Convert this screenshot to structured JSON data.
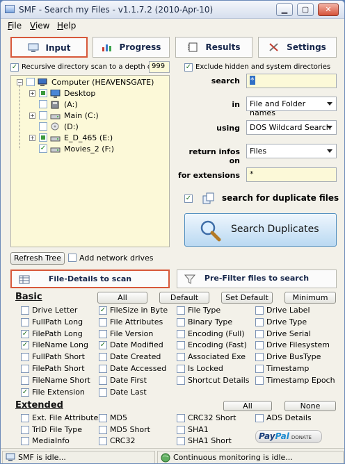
{
  "window": {
    "title": "SMF - Search my Files - v1.1.7.2 (2010-Apr-10)",
    "minimize": "▁",
    "maximize": "▢",
    "close": "✕"
  },
  "menu": [
    {
      "label": "File"
    },
    {
      "label": "View"
    },
    {
      "label": "Help"
    }
  ],
  "tabs": {
    "input": "Input",
    "progress": "Progress",
    "results": "Results",
    "settings": "Settings"
  },
  "scan": {
    "recursive_label": "Recursive directory scan to a depth of",
    "depth": "999",
    "exclude_label": "Exclude hidden and system directories"
  },
  "tree": {
    "root": "Computer (HEAVENSGATE)",
    "nodes": [
      "Desktop",
      "(A:)",
      "Main (C:)",
      "(D:)",
      "E_D_465 (E:)",
      "Movies_2 (F:)"
    ]
  },
  "form": {
    "search_label": "search",
    "search_value": "*",
    "in_label": "in",
    "in_value": "File and Folder names",
    "using_label": "using",
    "using_value": "DOS Wildcard Search",
    "return_label": "return infos on",
    "return_value": "Files",
    "ext_label": "for extensions",
    "ext_value": "*",
    "dup_label": "search for duplicate files",
    "big_button": "Search Duplicates"
  },
  "tree_controls": {
    "refresh": "Refresh Tree",
    "network": "Add network drives"
  },
  "subtabs": {
    "details": "File-Details to scan",
    "prefilter": "Pre-Filter files to search"
  },
  "basic": {
    "heading": "Basic",
    "all": "All",
    "default": "Default",
    "set_default": "Set Default",
    "minimum": "Minimum",
    "col1": [
      {
        "label": "Drive Letter",
        "checked": false
      },
      {
        "label": "FullPath Long",
        "checked": false
      },
      {
        "label": "FilePath Long",
        "checked": true
      },
      {
        "label": "FileName Long",
        "checked": true
      },
      {
        "label": "FullPath Short",
        "checked": false
      },
      {
        "label": "FilePath Short",
        "checked": false
      },
      {
        "label": "FileName Short",
        "checked": false
      },
      {
        "label": "File Extension",
        "checked": true
      }
    ],
    "col2": [
      {
        "label": "FileSize in Byte",
        "checked": true
      },
      {
        "label": "File Attributes",
        "checked": false
      },
      {
        "label": "File Version",
        "checked": false
      },
      {
        "label": "Date Modified",
        "checked": true
      },
      {
        "label": "Date Created",
        "checked": false
      },
      {
        "label": "Date Accessed",
        "checked": false
      },
      {
        "label": "Date First",
        "checked": false
      },
      {
        "label": "Date Last",
        "checked": false
      }
    ],
    "col3": [
      {
        "label": "File Type",
        "checked": false
      },
      {
        "label": "Binary Type",
        "checked": false
      },
      {
        "label": "Encoding (Full)",
        "checked": false
      },
      {
        "label": "Encoding (Fast)",
        "checked": false
      },
      {
        "label": "Associated Exe",
        "checked": false
      },
      {
        "label": "Is Locked",
        "checked": false
      },
      {
        "label": "Shortcut Details",
        "checked": false
      }
    ],
    "col4": [
      {
        "label": "Drive Label",
        "checked": false
      },
      {
        "label": "Drive Type",
        "checked": false
      },
      {
        "label": "Drive Serial",
        "checked": false
      },
      {
        "label": "Drive Filesystem",
        "checked": false
      },
      {
        "label": "Drive BusType",
        "checked": false
      },
      {
        "label": "Timestamp",
        "checked": false
      },
      {
        "label": "Timestamp Epoch",
        "checked": false
      }
    ]
  },
  "extended": {
    "heading": "Extended",
    "all": "All",
    "none": "None",
    "col1": [
      {
        "label": "Ext. File Attributes",
        "checked": false
      },
      {
        "label": "TrID File Type",
        "checked": false
      },
      {
        "label": "MediaInfo",
        "checked": false
      }
    ],
    "col2": [
      {
        "label": "MD5",
        "checked": false
      },
      {
        "label": "MD5 Short",
        "checked": false
      },
      {
        "label": "CRC32",
        "checked": false
      }
    ],
    "col3": [
      {
        "label": "CRC32 Short",
        "checked": false
      },
      {
        "label": "SHA1",
        "checked": false
      },
      {
        "label": "SHA1 Short",
        "checked": false
      }
    ],
    "col4": [
      {
        "label": "ADS Details",
        "checked": false
      }
    ]
  },
  "paypal": {
    "pay": "Pay",
    "pal": "Pal",
    "donate": "DONATE"
  },
  "status": {
    "left": "SMF is idle...",
    "right": "Continuous monitoring is idle..."
  }
}
